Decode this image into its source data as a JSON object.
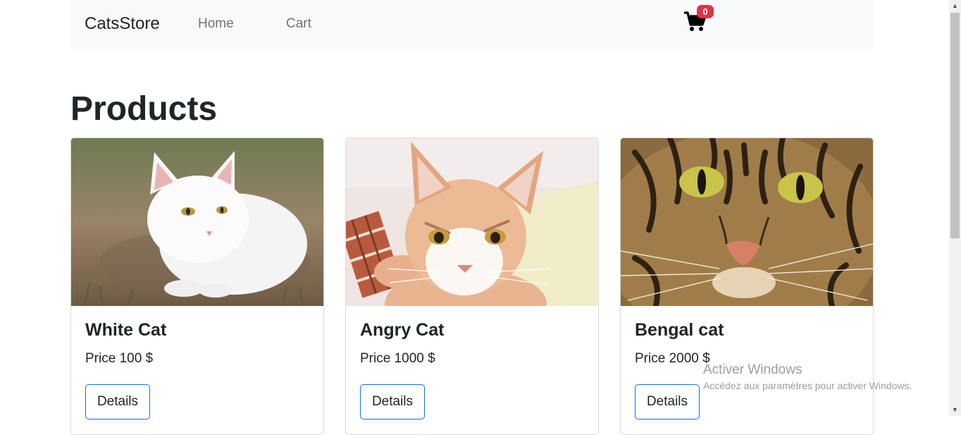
{
  "navbar": {
    "brand": "CatsStore",
    "links": [
      {
        "label": "Home"
      },
      {
        "label": "Cart"
      }
    ],
    "cart_icon": "shopping-cart-icon",
    "cart_count": "0"
  },
  "page": {
    "title": "Products"
  },
  "products": [
    {
      "name": "White Cat",
      "price": "Price 100 $",
      "button_label": "Details",
      "image": "white-cat-photo"
    },
    {
      "name": "Angry Cat",
      "price": "Price 1000 $",
      "button_label": "Details",
      "image": "angry-cat-photo"
    },
    {
      "name": "Bengal cat",
      "price": "Price 2000 $",
      "button_label": "Details",
      "image": "bengal-cat-photo"
    }
  ],
  "watermark": {
    "title": "Activer Windows",
    "subtitle": "Accédez aux paramètres pour activer Windows."
  },
  "colors": {
    "navbar_bg": "#f8f9fa",
    "badge": "#dc3545",
    "button_border": "#0d6efd"
  }
}
